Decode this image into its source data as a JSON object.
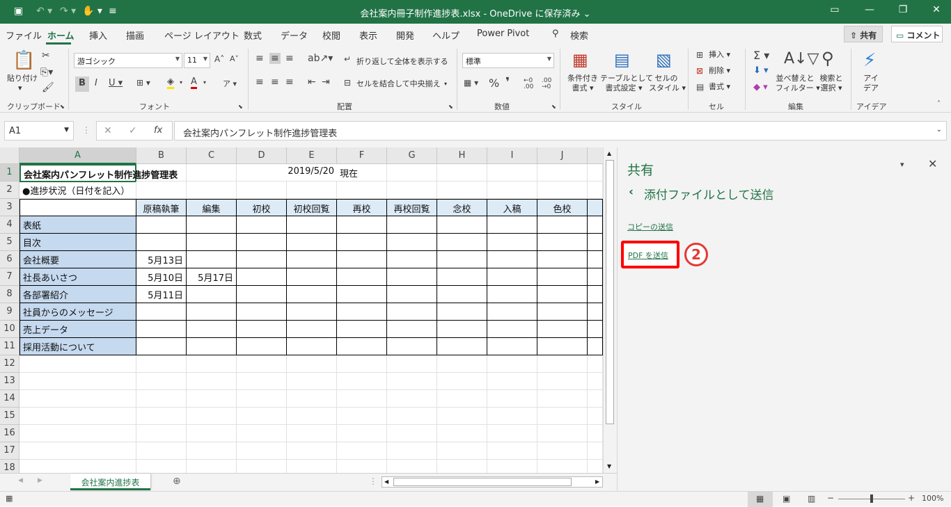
{
  "titlebar": {
    "title": "会社案内冊子制作進捗表.xlsx  -  OneDrive に保存済み  ⌄"
  },
  "menu": {
    "tabs": [
      "ファイル",
      "ホーム",
      "挿入",
      "描画",
      "ページ レイアウト",
      "数式",
      "データ",
      "校閲",
      "表示",
      "開発",
      "ヘルプ",
      "Power Pivot",
      "検索"
    ],
    "share": "共有",
    "comment": "コメント"
  },
  "ribbon": {
    "paste": "貼り付け",
    "font_name": "游ゴシック",
    "font_size": "11",
    "wrap_text": "折り返して全体を表示する",
    "merge_center": "セルを結合して中央揃え",
    "number_format": "標準",
    "cond_format": [
      "条件付き",
      "書式"
    ],
    "table_format": [
      "テーブルとして",
      "書式設定"
    ],
    "cell_style": [
      "セルの",
      "スタイル"
    ],
    "insert": "挿入",
    "delete": "削除",
    "format": "書式",
    "sort_filter": [
      "並べ替えと",
      "フィルター"
    ],
    "find_select": [
      "検索と",
      "選択"
    ],
    "ideas": [
      "アイ",
      "デア"
    ],
    "groups": [
      "クリップボード",
      "フォント",
      "配置",
      "数値",
      "スタイル",
      "セル",
      "編集",
      "アイデア"
    ]
  },
  "formula": {
    "namebox": "A1",
    "content": "会社案内パンフレット制作進捗管理表"
  },
  "sheet": {
    "columns": [
      "A",
      "B",
      "C",
      "D",
      "E",
      "F",
      "G",
      "H",
      "I",
      "J"
    ],
    "rows": [
      "1",
      "2",
      "3",
      "4",
      "5",
      "6",
      "7",
      "8",
      "9",
      "10",
      "11",
      "12",
      "13",
      "14",
      "15",
      "16",
      "17",
      "18"
    ],
    "title": "会社案内パンフレット制作進捗管理表",
    "date": "2019/5/20",
    "date_suffix": "現在",
    "subtitle": "●進捗状況（日付を記入）",
    "headers": [
      "原稿執筆",
      "編集",
      "初校",
      "初校回覧",
      "再校",
      "再校回覧",
      "念校",
      "入稿",
      "色校"
    ],
    "items": [
      "表紙",
      "目次",
      "会社概要",
      "社長あいさつ",
      "各部署紹介",
      "社員からのメッセージ",
      "売上データ",
      "採用活動について"
    ],
    "values": {
      "b6": "5月13日",
      "b7": "5月10日",
      "c7": "5月17日",
      "b8": "5月11日"
    }
  },
  "sheet_tab": "会社案内進捗表",
  "pane": {
    "title": "共有",
    "subtitle": "添付ファイルとして送信",
    "link_copy": "コピーの送信",
    "link_pdf": "PDF を送信",
    "step": "2"
  },
  "status": {
    "zoom": "100%"
  }
}
